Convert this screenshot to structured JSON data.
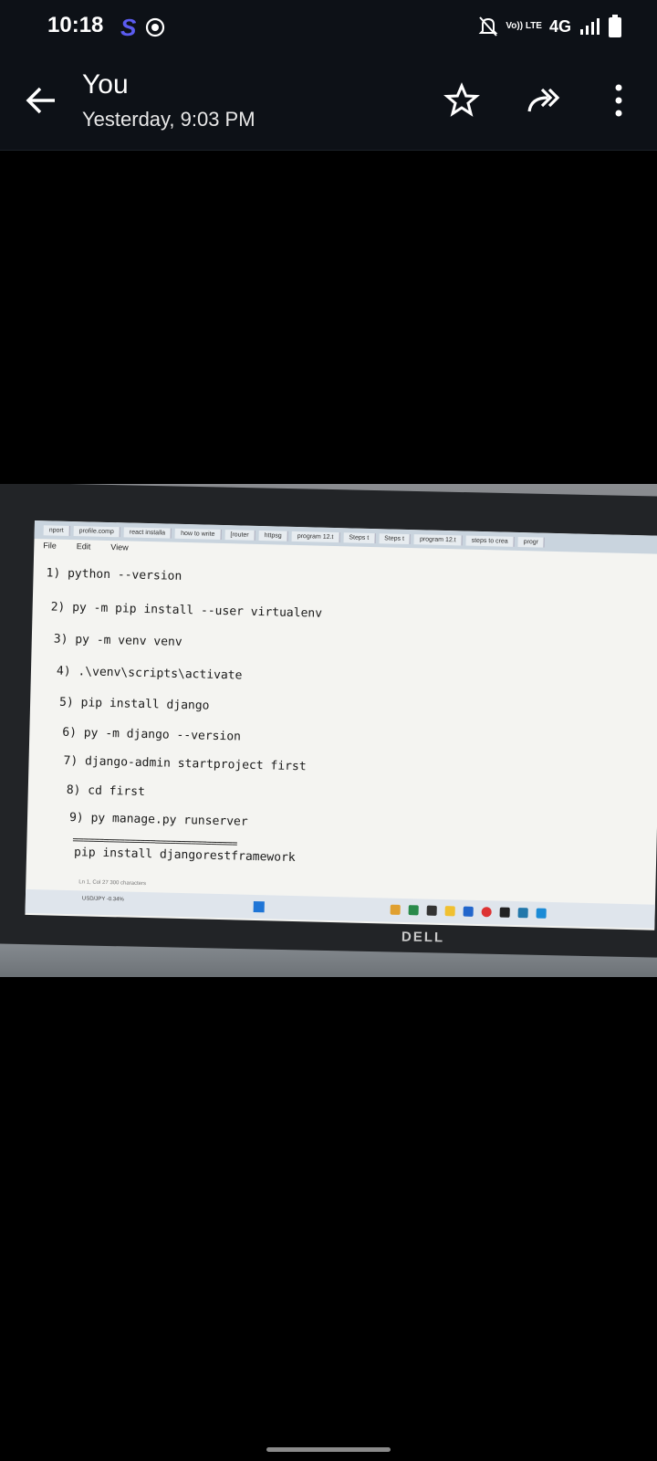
{
  "status_bar": {
    "time": "10:18",
    "left_icons": [
      "skype-s-icon",
      "whatsapp-icon"
    ],
    "network": "4G",
    "volte": "Vo)) LTE",
    "right_icons": [
      "bell-off-icon",
      "volte-icon",
      "signal-icon",
      "battery-icon"
    ]
  },
  "header": {
    "sender": "You",
    "timestamp": "Yesterday, 9:03 PM",
    "actions": [
      "back-icon",
      "star-icon",
      "forward-icon",
      "more-vert-icon"
    ]
  },
  "photo": {
    "tabs": [
      "nport",
      "profile.comp",
      "react installa",
      "how to write",
      "[router",
      "httpsg",
      "program 12.t",
      "Steps t",
      "Steps t",
      "program 12.t",
      "steps to crea",
      "progr"
    ],
    "menu": [
      "File",
      "Edit",
      "View"
    ],
    "code_lines": [
      "1) python --version",
      "2) py -m pip install --user virtualenv",
      "3) py -m venv venv",
      "4) .\\venv\\scripts\\activate",
      "5) pip install django",
      "6) py -m django --version",
      "7) django-admin startproject first",
      "8) cd first",
      "9) py manage.py runserver",
      "================================",
      "pip install djangorestframework"
    ],
    "editor_status": "Ln 1, Col 27     300 characters",
    "ticker": "USD/JPY -0.34%",
    "monitor_brand": "DELL"
  }
}
